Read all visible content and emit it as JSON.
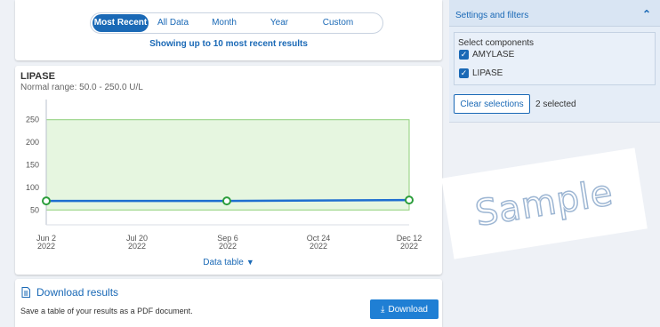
{
  "filters": {
    "segments": [
      "Most Recent",
      "All Data",
      "Month",
      "Year",
      "Custom"
    ],
    "active_index": 0,
    "showing_text": "Showing up to 10 most recent results"
  },
  "chart": {
    "title": "LIPASE",
    "normal_range": "Normal range: 50.0 - 250.0 U/L",
    "data_table_label": "Data table"
  },
  "chart_data": {
    "type": "line",
    "title": "LIPASE",
    "xlabel": "",
    "ylabel": "",
    "ylim": [
      25,
      275
    ],
    "yticks": [
      50,
      100,
      150,
      200,
      250
    ],
    "xticks": [
      {
        "line1": "Jun 2",
        "line2": "2022"
      },
      {
        "line1": "Jul 20",
        "line2": "2022"
      },
      {
        "line1": "Sep 6",
        "line2": "2022"
      },
      {
        "line1": "Oct 24",
        "line2": "2022"
      },
      {
        "line1": "Dec 12",
        "line2": "2022"
      }
    ],
    "normal_band": [
      50,
      250
    ],
    "series": [
      {
        "x": [
          "2022-06-02",
          "2022-09-06",
          "2022-12-12"
        ],
        "values": [
          70,
          70,
          72
        ]
      }
    ],
    "colors": {
      "line": "#1f6fd0",
      "marker": "#2a9d3a",
      "band_fill": "#e6f6e0",
      "band_stroke": "#8fd07a"
    },
    "grid": false
  },
  "download": {
    "heading": "Download results",
    "description": "Save a table of your results as a PDF document.",
    "button_label": "Download"
  },
  "settings": {
    "title": "Settings and filters",
    "select_label": "Select components",
    "components": [
      {
        "label": "AMYLASE",
        "checked": true
      },
      {
        "label": "LIPASE",
        "checked": true
      }
    ],
    "clear_label": "Clear selections",
    "selected_count": "2 selected"
  },
  "watermark": {
    "text": "Sample"
  },
  "colors": {
    "accent": "#1a69b6",
    "page_bg": "#eef1f6",
    "button_bg": "#1f7fd4"
  }
}
